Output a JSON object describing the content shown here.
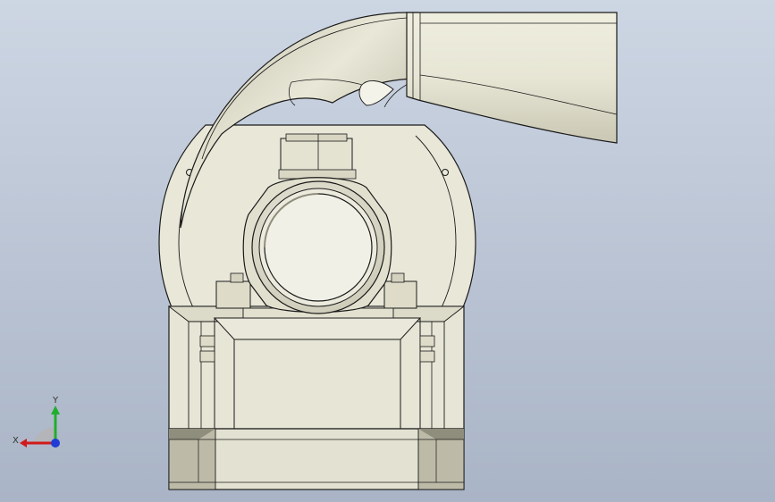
{
  "triad": {
    "x_label": "X",
    "y_label": "Y"
  },
  "colors": {
    "part_fill": "#e6e5d7",
    "part_shade": "#cfcdbb",
    "edge": "#1a1a1a",
    "x_axis": "#d11a1a",
    "y_axis": "#1fae2b",
    "z_axis": "#1e3cd6"
  }
}
